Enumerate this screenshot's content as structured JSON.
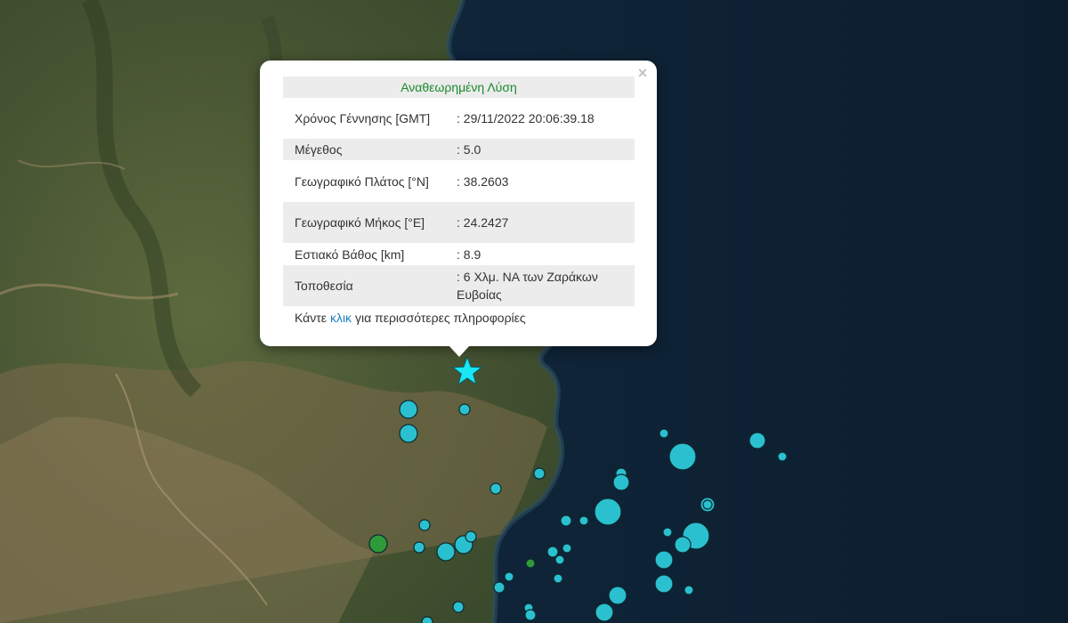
{
  "popup": {
    "title": "Αναθεωρημένη Λύση",
    "close_label": "×",
    "rows": [
      {
        "label": "Χρόνος Γέννησης [GMT]",
        "value": ": 29/11/2022 20:06:39.18"
      },
      {
        "label": "Μέγεθος",
        "value": ": 5.0"
      },
      {
        "label": "Γεωγραφικό Πλάτος [°N]",
        "value": ": 38.2603"
      },
      {
        "label": "Γεωγραφικό Μήκος [°E]",
        "value": ": 24.2427"
      },
      {
        "label": "Εστιακό Βάθος [km]",
        "value": ": 8.9"
      },
      {
        "label": "Τοποθεσία",
        "value": ": 6 Χλμ. ΝΑ των Ζαράκων Ευβοίας"
      }
    ],
    "more_prefix": "Κάντε",
    "more_link": "κλικ",
    "more_suffix": "για περισσότερες πληροφορίες"
  },
  "map": {
    "epicenter_icon": "star-icon",
    "colors": {
      "sea": "#0e2236",
      "land": "#4a5232",
      "marker_cyan": "#2bc0cf",
      "marker_green": "#2e9a3a",
      "epicenter": "#19e6f2"
    }
  }
}
